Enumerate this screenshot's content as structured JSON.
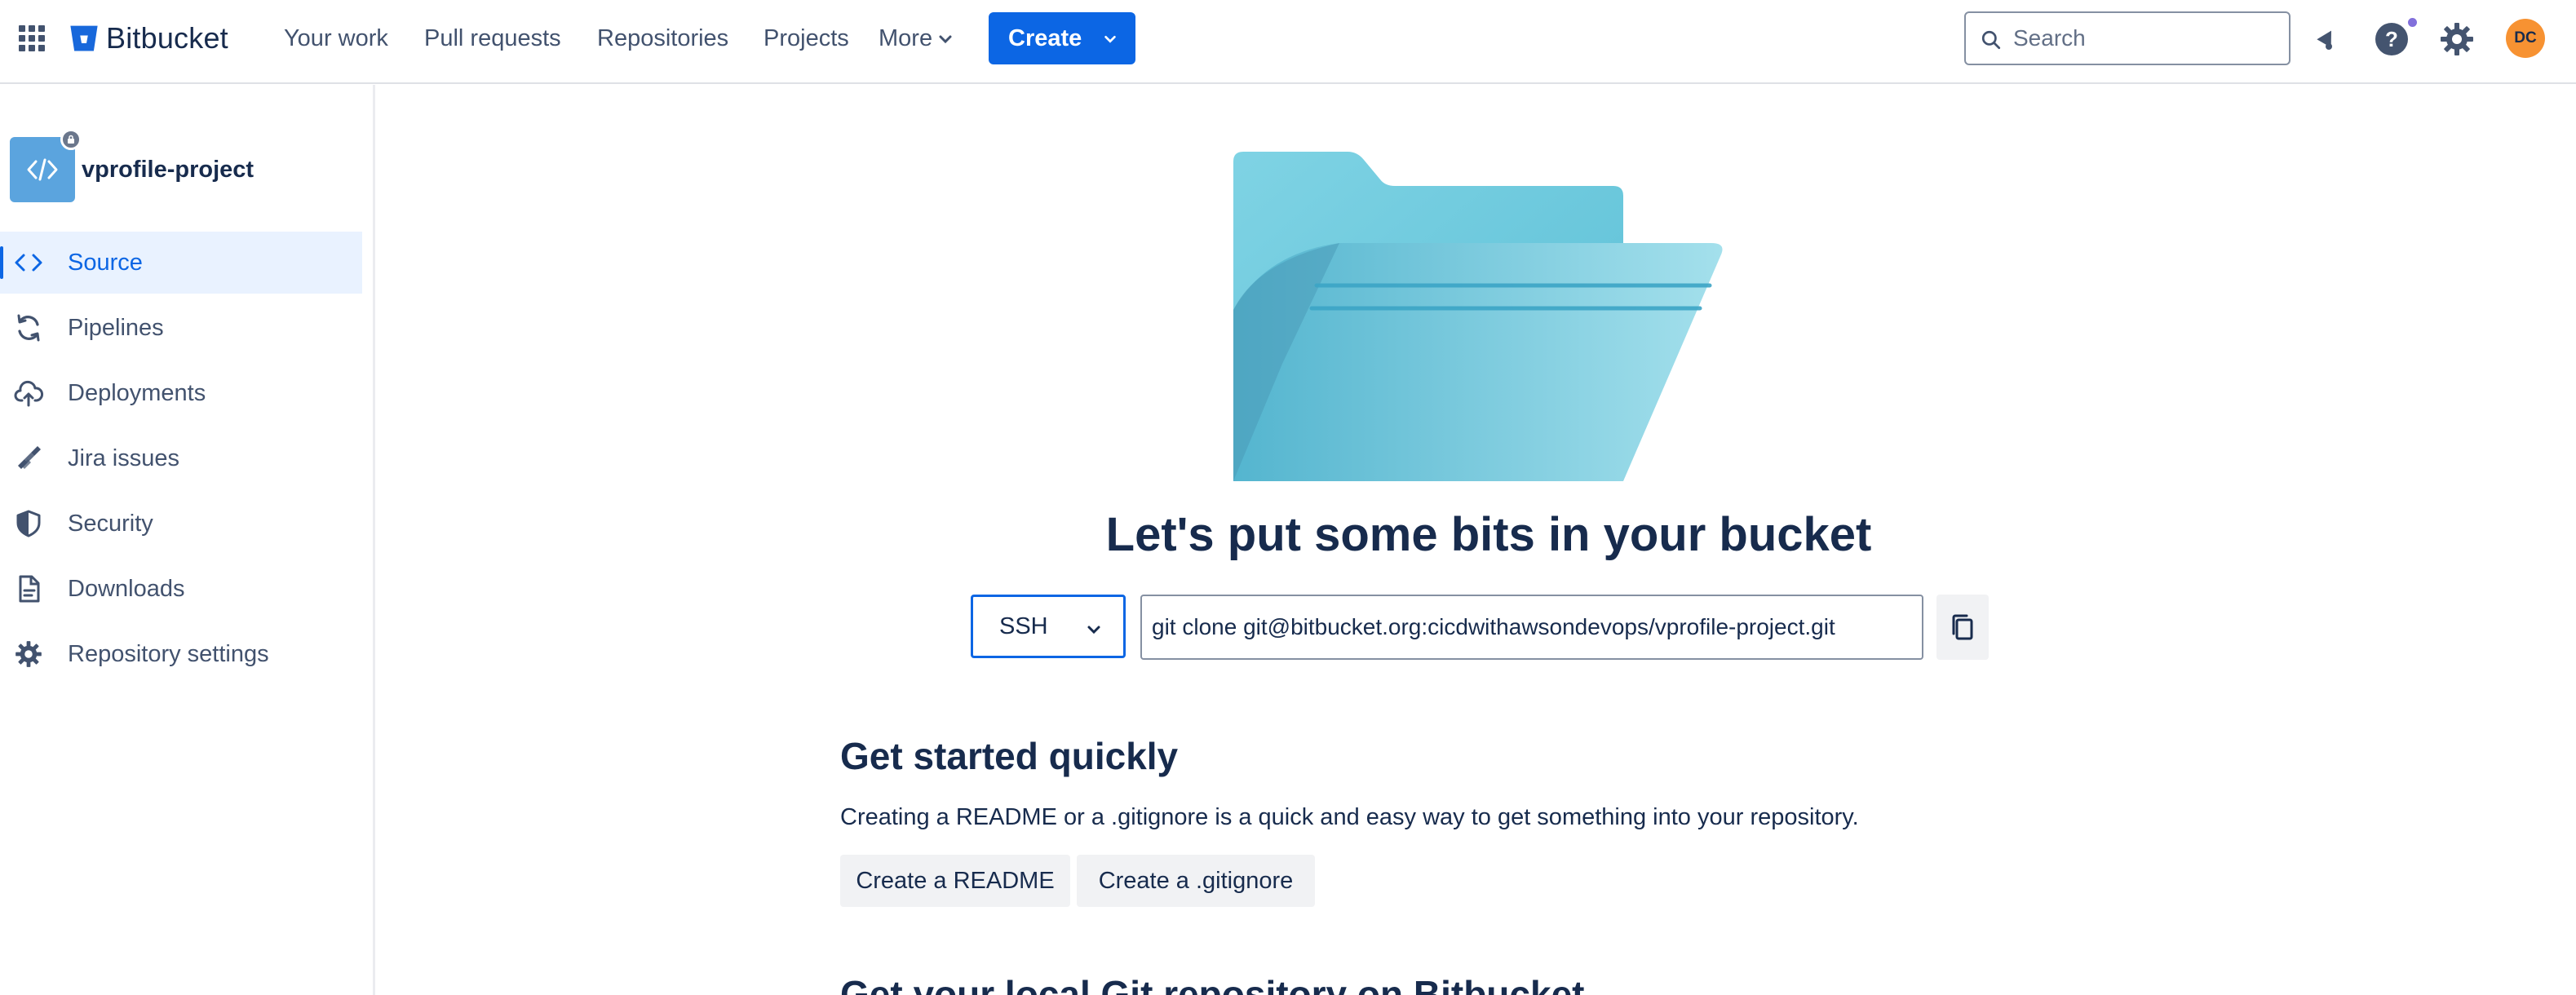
{
  "topnav": {
    "logo_text": "Bitbucket",
    "items": [
      "Your work",
      "Pull requests",
      "Repositories",
      "Projects",
      "More"
    ],
    "create_label": "Create",
    "search_placeholder": "Search",
    "avatar_initials": "DC",
    "icons": [
      "app-switcher-icon",
      "notifications-icon",
      "help-icon",
      "settings-icon"
    ],
    "colors": {
      "primary": "#0c66e4",
      "avatar": "#f79232",
      "notification_dot": "#8270db"
    }
  },
  "sidebar": {
    "repo_name": "vprofile-project",
    "items": [
      {
        "label": "Source",
        "icon": "code-icon",
        "active": true
      },
      {
        "label": "Pipelines",
        "icon": "pipelines-icon",
        "active": false
      },
      {
        "label": "Deployments",
        "icon": "deployments-icon",
        "active": false
      },
      {
        "label": "Jira issues",
        "icon": "jira-icon",
        "active": false
      },
      {
        "label": "Security",
        "icon": "shield-icon",
        "active": false
      },
      {
        "label": "Downloads",
        "icon": "file-icon",
        "active": false
      },
      {
        "label": "Repository settings",
        "icon": "gear-icon",
        "active": false
      }
    ]
  },
  "main": {
    "hero_title": "Let's put some bits in your bucket",
    "clone_protocol": "SSH",
    "clone_command": "git clone git@bitbucket.org:cicdwithawsondevops/vprofile-project.git",
    "get_started_title": "Get started quickly",
    "get_started_desc": "Creating a README or a .gitignore is a quick and easy way to get something into your repository.",
    "create_readme_label": "Create a README",
    "create_gitignore_label": "Create a .gitignore",
    "next_section_title": "Get your local Git repository on Bitbucket"
  }
}
